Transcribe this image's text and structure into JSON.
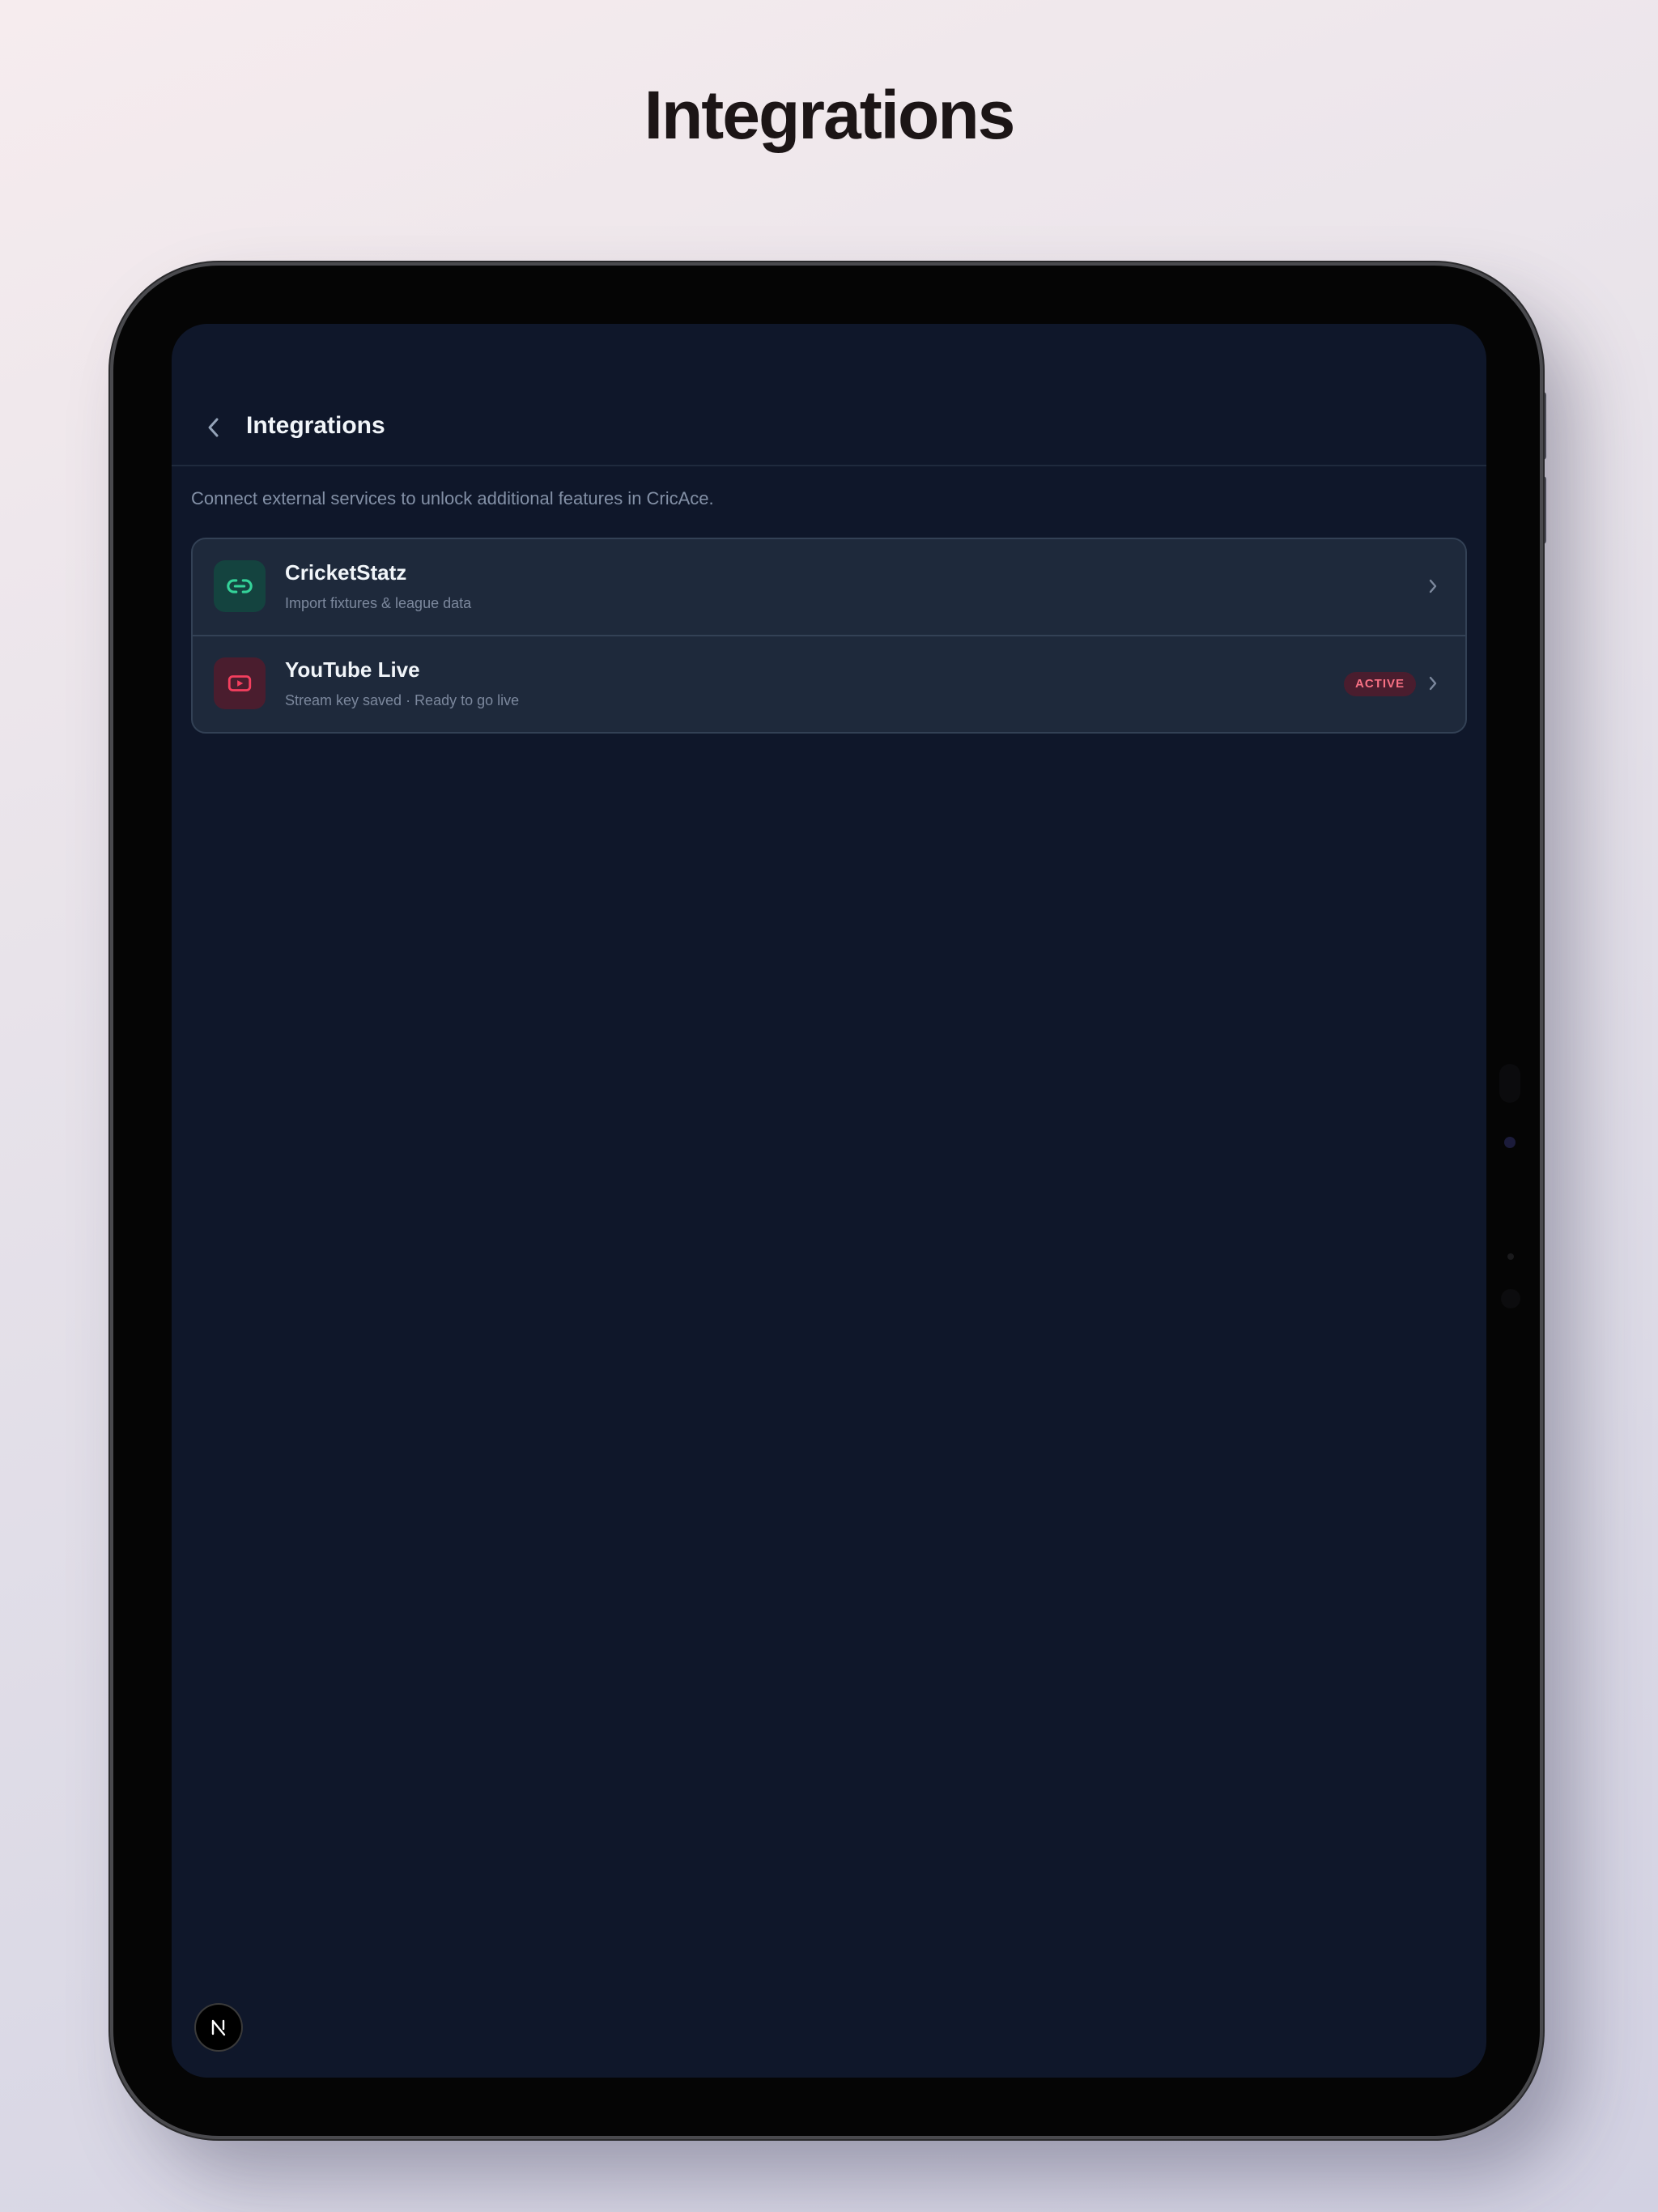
{
  "page": {
    "headline": "Integrations"
  },
  "screen": {
    "header": {
      "back_icon": "chevron-left-icon",
      "title": "Integrations"
    },
    "intro": "Connect external services to unlock additional features in CricAce.",
    "integrations": [
      {
        "icon": "link-icon",
        "accent": "#34d399",
        "title": "CricketStatz",
        "subtitle": "Import fixtures & league data",
        "badge": null
      },
      {
        "icon": "youtube-icon",
        "accent": "#f43f5e",
        "title": "YouTube Live",
        "subtitle": "Stream key saved · Ready to go live",
        "badge": "ACTIVE"
      }
    ],
    "fab": {
      "label": "N",
      "icon": "nextjs-logo-icon"
    }
  },
  "colors": {
    "background": "#0f172a",
    "card": "#1e293b",
    "border": "#334155",
    "accent_green": "#34d399",
    "accent_red": "#f43f5e"
  }
}
